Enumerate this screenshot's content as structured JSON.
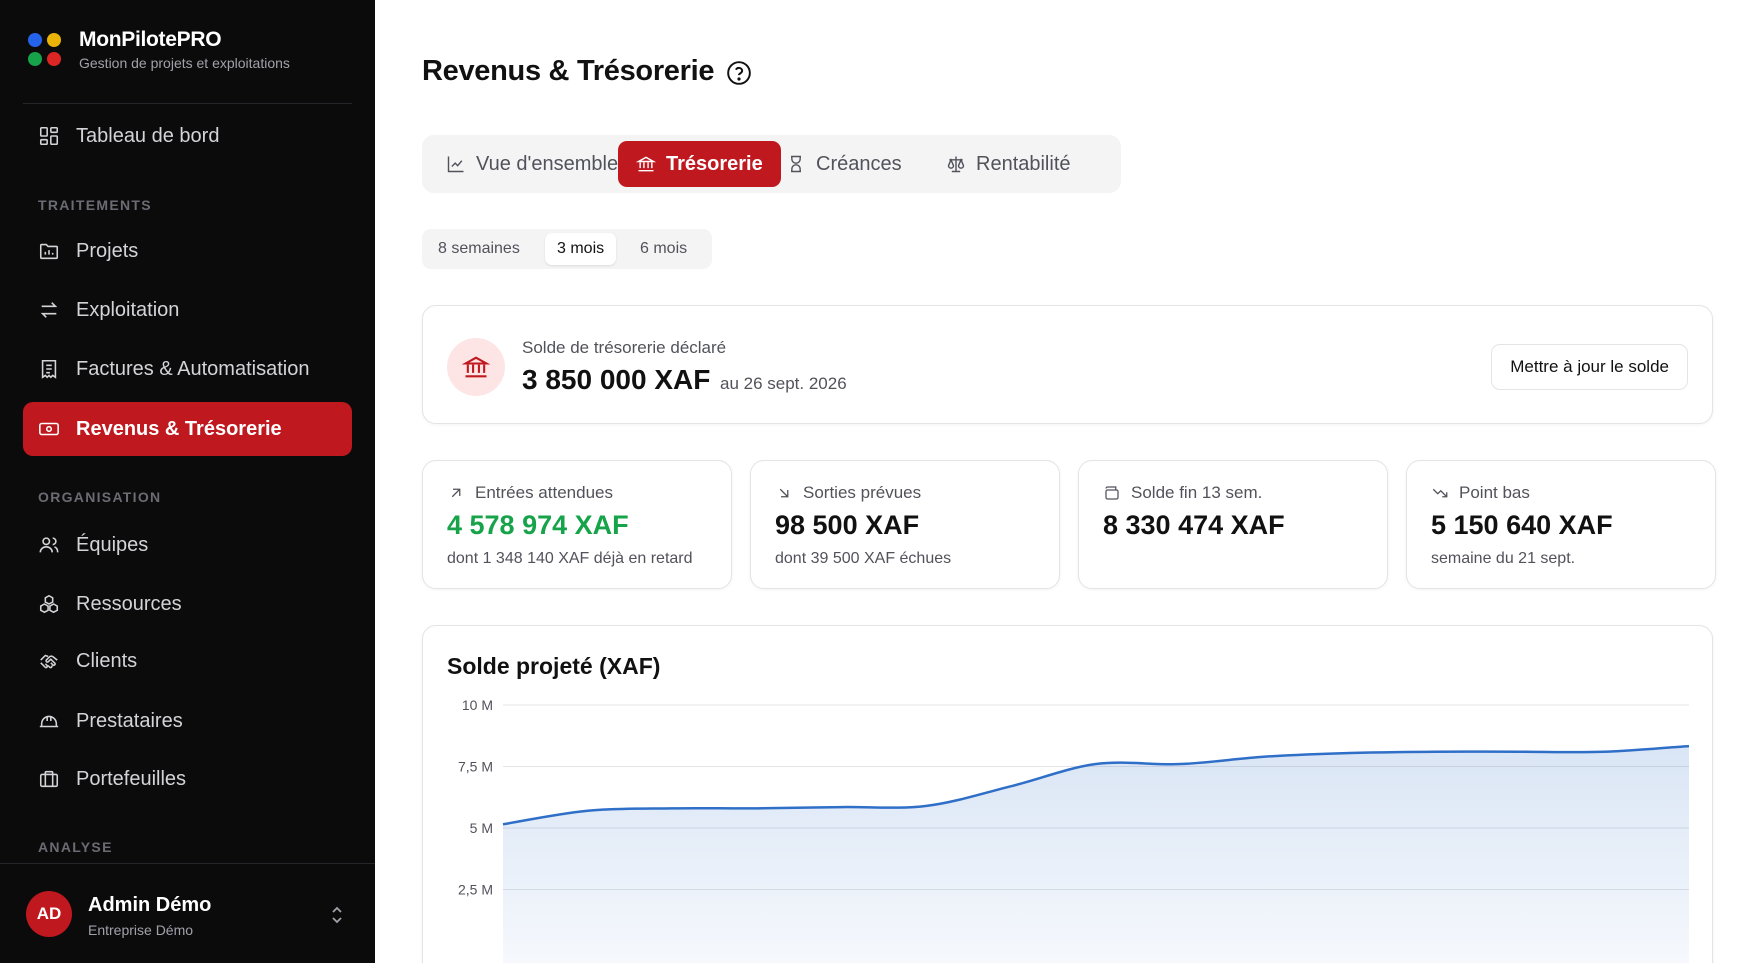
{
  "brand": {
    "name": "MonPilotePRO",
    "subtitle": "Gestion de projets et exploitations",
    "dot_colors": [
      "#2563eb",
      "#eab308",
      "#16a34a",
      "#dc2626"
    ]
  },
  "sidebar": {
    "top_item": {
      "label": "Tableau de bord",
      "icon": "dashboard-icon"
    },
    "sections": [
      {
        "title": "TRAITEMENTS",
        "items": [
          {
            "label": "Projets",
            "icon": "folder-icon"
          },
          {
            "label": "Exploitation",
            "icon": "arrows-icon"
          },
          {
            "label": "Factures & Automatisation",
            "icon": "invoice-icon"
          },
          {
            "label": "Revenus & Trésorerie",
            "icon": "banknote-icon",
            "active": true
          }
        ]
      },
      {
        "title": "ORGANISATION",
        "items": [
          {
            "label": "Équipes",
            "icon": "users-icon"
          },
          {
            "label": "Ressources",
            "icon": "boxes-icon"
          },
          {
            "label": "Clients",
            "icon": "handshake-icon"
          },
          {
            "label": "Prestataires",
            "icon": "hardhat-icon"
          },
          {
            "label": "Portefeuilles",
            "icon": "briefcase-icon"
          }
        ]
      },
      {
        "title": "ANALYSE",
        "items": []
      }
    ],
    "user": {
      "initials": "AD",
      "name": "Admin Démo",
      "org": "Entreprise Démo"
    }
  },
  "page": {
    "title": "Revenus & Trésorerie"
  },
  "tabs": [
    {
      "label": "Vue d'ensemble",
      "icon": "line-chart-icon"
    },
    {
      "label": "Trésorerie",
      "icon": "bank-icon",
      "active": true
    },
    {
      "label": "Créances",
      "icon": "hourglass-icon"
    },
    {
      "label": "Rentabilité",
      "icon": "scale-icon"
    }
  ],
  "periods": [
    {
      "label": "8 semaines"
    },
    {
      "label": "3 mois",
      "active": true
    },
    {
      "label": "6 mois"
    }
  ],
  "balance": {
    "label": "Solde de trésorerie déclaré",
    "value": "3 850 000 XAF",
    "date": "au 26 sept. 2026",
    "update_button": "Mettre à jour le solde"
  },
  "kpis": [
    {
      "label": "Entrées attendues",
      "value": "4 578 974 XAF",
      "sub": "dont 1 348 140 XAF déjà en retard",
      "icon": "arrow-up-right-icon",
      "value_color": "#16a34a"
    },
    {
      "label": "Sorties prévues",
      "value": "98 500 XAF",
      "sub": "dont 39 500 XAF échues",
      "icon": "arrow-down-right-icon"
    },
    {
      "label": "Solde fin 13 sem.",
      "value": "8 330 474 XAF",
      "sub": "",
      "icon": "wallet-icon"
    },
    {
      "label": "Point bas",
      "value": "5 150 640 XAF",
      "sub": "semaine du 21 sept.",
      "icon": "trending-down-icon"
    }
  ],
  "chart_data": {
    "type": "area",
    "title": "Solde projeté (XAF)",
    "yticks": [
      "10 M",
      "7,5 M",
      "5 M",
      "2,5 M"
    ],
    "ytick_values": [
      10000000,
      7500000,
      5000000,
      2500000
    ],
    "ylim": [
      0,
      10000000
    ],
    "grid": true,
    "series": [
      {
        "values": [
          5150640,
          5700000,
          5800000,
          5800000,
          5850000,
          5900000,
          6700000,
          7600000,
          7600000,
          7900000,
          8050000,
          8100000,
          8100000,
          8100000,
          8330474
        ]
      }
    ],
    "color": "#2f6fc8"
  },
  "colors": {
    "accent": "#c0181f",
    "positive": "#16a34a",
    "line": "#2f6fc8"
  }
}
